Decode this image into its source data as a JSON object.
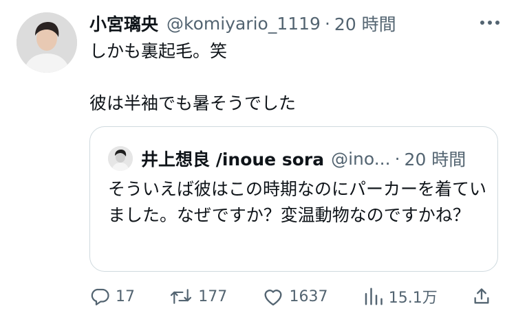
{
  "tweet": {
    "author_name": "小宮璃央",
    "handle": "@komiyario_1119",
    "separator": "·",
    "time": "20 時間",
    "lines": [
      "しかも裏起毛。笑",
      "彼は半袖でも暑そうでした"
    ]
  },
  "quote": {
    "author_name": "井上想良 /inoue sora",
    "handle": "@ino...",
    "separator": "·",
    "time": "20 時間",
    "text": "そういえば彼はこの時期なのにパーカーを着ていました。なぜですか？変温動物なのですかね？"
  },
  "actions": {
    "replies": "17",
    "retweets": "177",
    "likes": "1637",
    "views": "15.1万"
  },
  "icons": {
    "more": "more-icon",
    "reply": "reply-icon",
    "retweet": "retweet-icon",
    "like": "heart-icon",
    "views": "views-icon",
    "share": "share-icon"
  },
  "colors": {
    "text": "#0f1419",
    "secondary": "#536471",
    "border": "#cfd9de"
  }
}
